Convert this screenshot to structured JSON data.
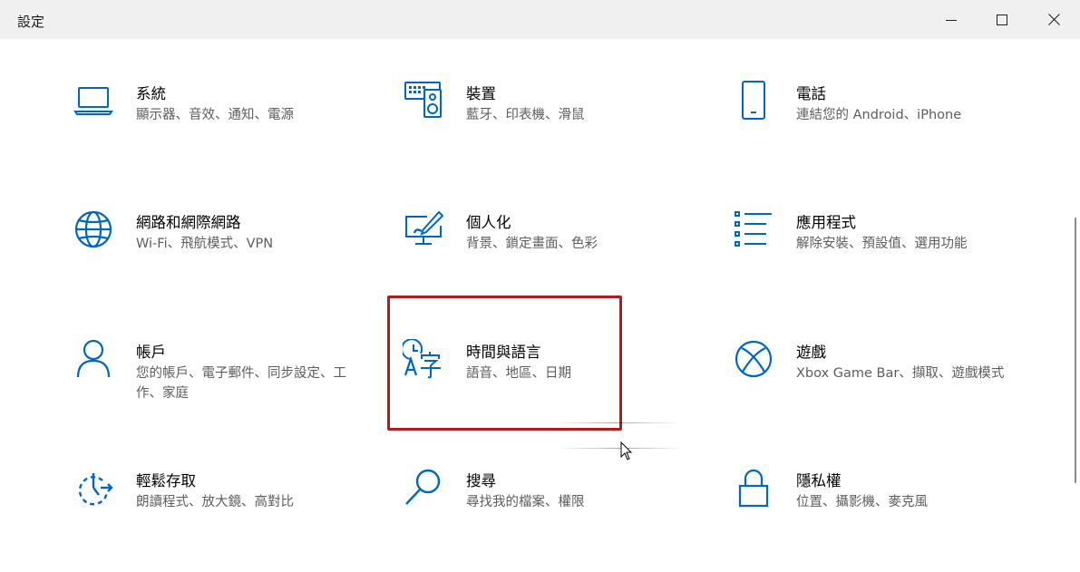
{
  "window": {
    "title": "設定"
  },
  "tiles": [
    {
      "name": "系統",
      "desc": "顯示器、音效、通知、電源",
      "icon": "laptop-icon"
    },
    {
      "name": "裝置",
      "desc": "藍牙、印表機、滑鼠",
      "icon": "keyboard-speaker-icon"
    },
    {
      "name": "電話",
      "desc": "連結您的 Android、iPhone",
      "icon": "phone-icon"
    },
    {
      "name": "網路和網際網路",
      "desc": "Wi-Fi、飛航模式、VPN",
      "icon": "globe-icon"
    },
    {
      "name": "個人化",
      "desc": "背景、鎖定畫面、色彩",
      "icon": "paint-screen-icon"
    },
    {
      "name": "應用程式",
      "desc": "解除安裝、預設值、選用功能",
      "icon": "app-list-icon"
    },
    {
      "name": "帳戶",
      "desc": "您的帳戶、電子郵件、同步設定、工作、家庭",
      "icon": "person-icon"
    },
    {
      "name": "時間與語言",
      "desc": "語音、地區、日期",
      "icon": "time-language-icon"
    },
    {
      "name": "遊戲",
      "desc": "Xbox Game Bar、擷取、遊戲模式",
      "icon": "xbox-icon"
    },
    {
      "name": "輕鬆存取",
      "desc": "朗讀程式、放大鏡、高對比",
      "icon": "ease-of-access-icon"
    },
    {
      "name": "搜尋",
      "desc": "尋找我的檔案、權限",
      "icon": "search-icon"
    },
    {
      "name": "隱私權",
      "desc": "位置、攝影機、麥克風",
      "icon": "lock-icon"
    }
  ],
  "colors": {
    "accent": "#0067c0",
    "titlebar": "#f0f0f0",
    "highlight": "#b01c1c",
    "description": "#5d5d5d"
  }
}
